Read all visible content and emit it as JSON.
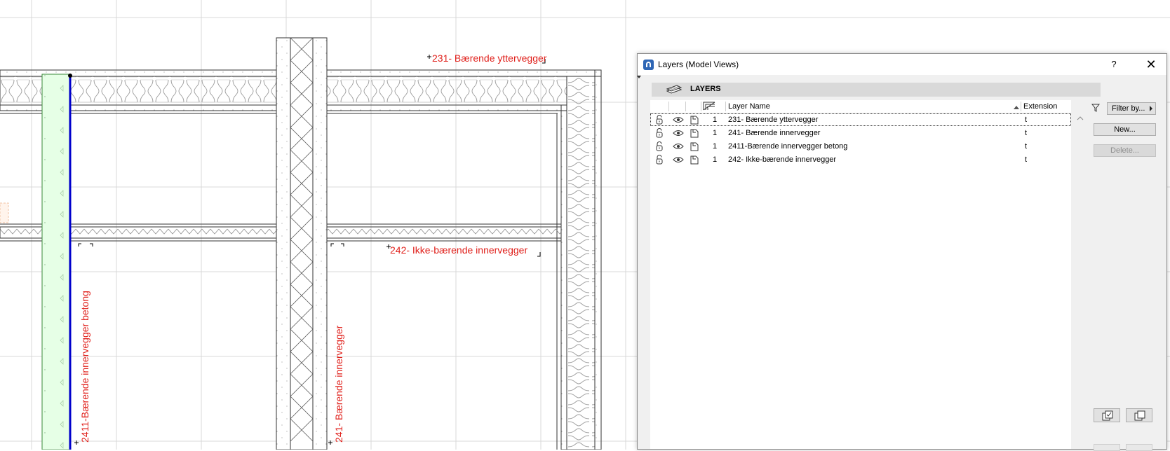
{
  "drawing": {
    "label_231": "231- Bærende yttervegger",
    "label_242": "242- Ikke-bærende innervegger",
    "label_2411": "2411-Bærende innervegger betong",
    "label_241": "241- Bærende innervegger",
    "colors": {
      "label": "#e0201b",
      "grid": "#d9d9d9",
      "wall_line": "#0000cc",
      "fill_green": "#e6ffe6"
    }
  },
  "dialog": {
    "title": "Layers (Model Views)",
    "help": "?",
    "close": "✕",
    "section_title": "LAYERS",
    "columns": {
      "name": "Layer Name",
      "extension": "Extension"
    },
    "rows": [
      {
        "num": "1",
        "name": "231- Bærende yttervegger",
        "ext": "t",
        "selected": true
      },
      {
        "num": "1",
        "name": "241- Bærende innervegger",
        "ext": "t",
        "selected": false
      },
      {
        "num": "1",
        "name": "2411-Bærende innervegger betong",
        "ext": "t",
        "selected": false
      },
      {
        "num": "1",
        "name": "242- Ikke-bærende innervegger",
        "ext": "t",
        "selected": false
      }
    ],
    "buttons": {
      "filter": "Filter by...",
      "new": "New...",
      "delete": "Delete..."
    },
    "icons": [
      "layers-icon",
      "lock-icon",
      "eye-icon",
      "file-icon",
      "filter-icon",
      "scroll-up-icon",
      "copy-layer-icon",
      "duplicate-icon"
    ]
  }
}
